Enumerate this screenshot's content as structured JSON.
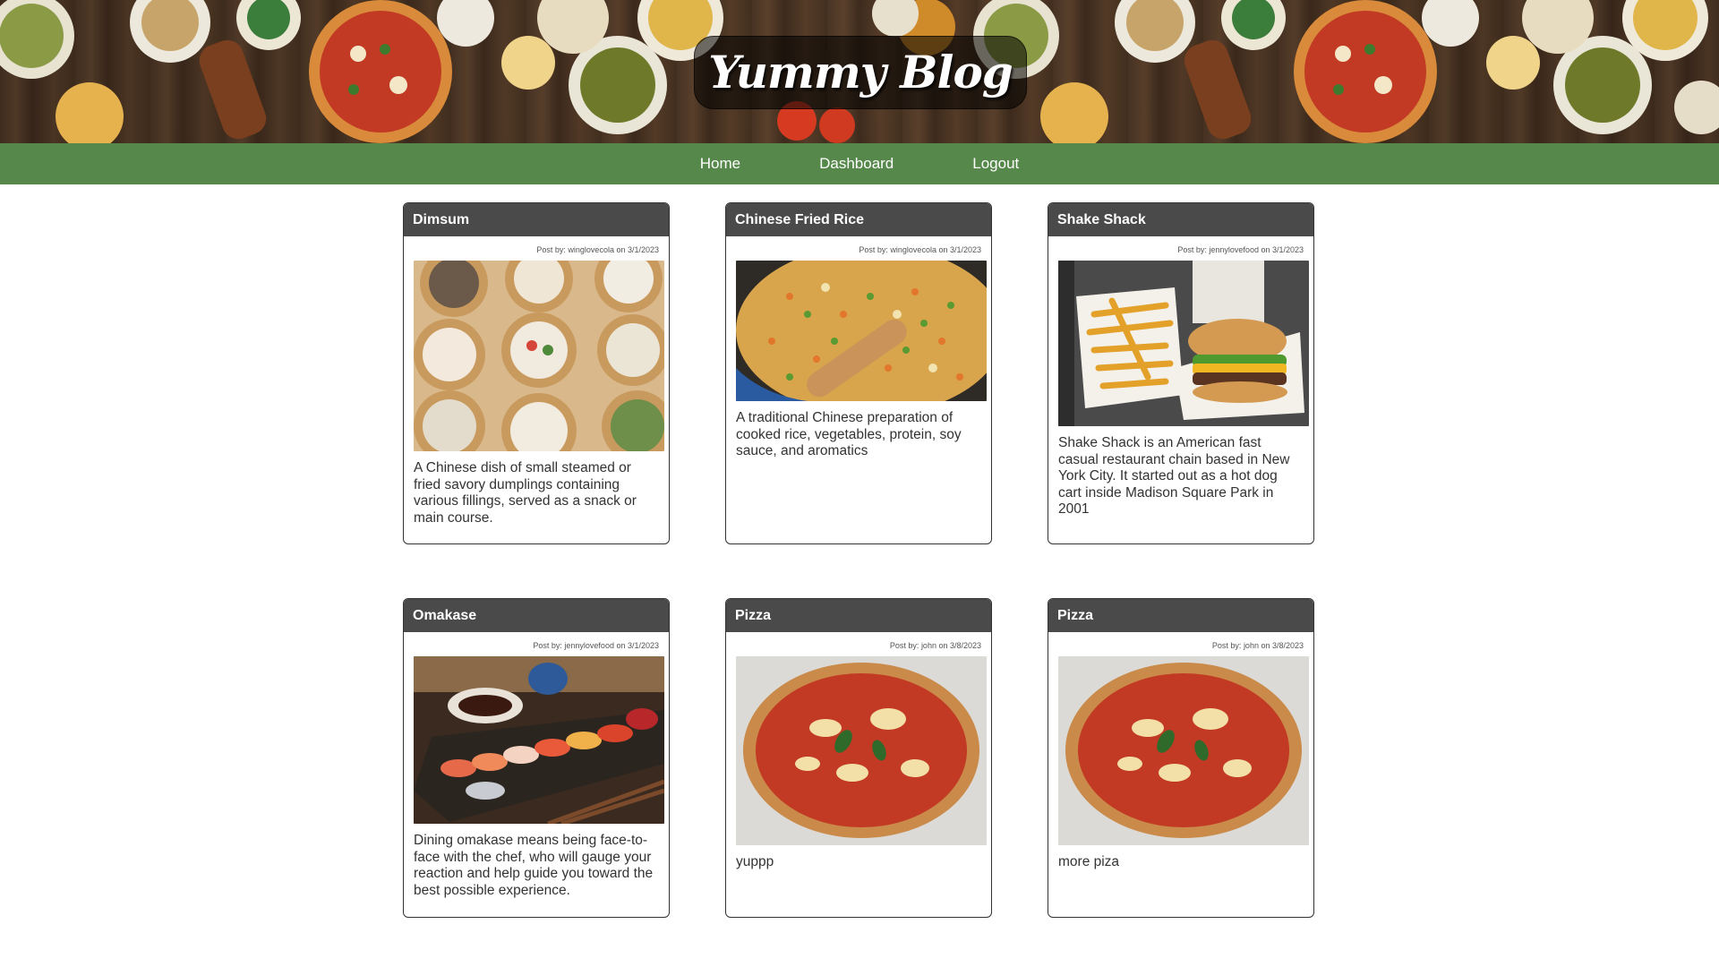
{
  "site": {
    "title": "Yummy Blog"
  },
  "nav": {
    "items": [
      {
        "label": "Home"
      },
      {
        "label": "Dashboard"
      },
      {
        "label": "Logout"
      }
    ]
  },
  "posts": [
    {
      "title": "Dimsum",
      "meta": "Post by: winglovecola on 3/1/2023",
      "image": "dimsum-photo",
      "description": "A Chinese dish of small steamed or fried savory dumplings containing various fillings, served as a snack or main course."
    },
    {
      "title": "Chinese Fried Rice",
      "meta": "Post by: winglovecola on 3/1/2023",
      "image": "fried-rice-photo",
      "description": "A traditional Chinese preparation of cooked rice, vegetables, protein, soy sauce, and aromatics"
    },
    {
      "title": "Shake Shack",
      "meta": "Post by: jennylovefood on 3/1/2023",
      "image": "burger-fries-photo",
      "description": "Shake Shack is an American fast casual restaurant chain based in New York City. It started out as a hot dog cart inside Madison Square Park in 2001"
    },
    {
      "title": "Omakase",
      "meta": "Post by: jennylovefood on 3/1/2023",
      "image": "sushi-photo",
      "description": "Dining omakase means being face-to-face with the chef, who will gauge your reaction and help guide you toward the best possible experience."
    },
    {
      "title": "Pizza",
      "meta": "Post by: john on 3/8/2023",
      "image": "pizza-photo",
      "description": "yuppp"
    },
    {
      "title": "Pizza",
      "meta": "Post by: john on 3/8/2023",
      "image": "pizza-photo",
      "description": "more piza"
    }
  ],
  "colors": {
    "nav_green": "#55884a",
    "card_header": "#4a4a4a"
  }
}
